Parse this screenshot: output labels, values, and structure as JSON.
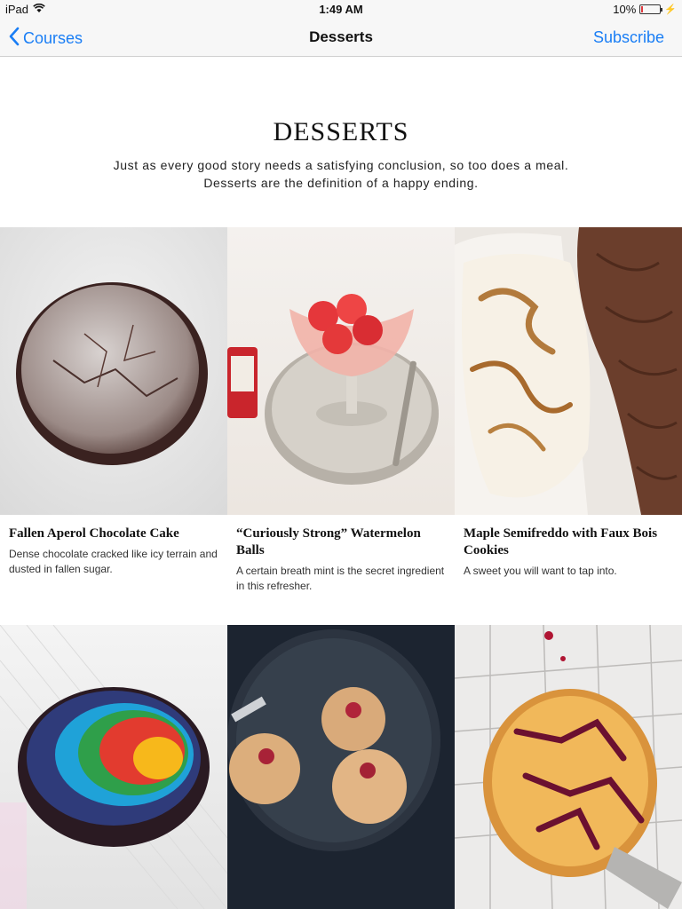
{
  "status": {
    "device": "iPad",
    "time": "1:49 AM",
    "battery": "10%",
    "battery_level": 0.1
  },
  "nav": {
    "back_label": "Courses",
    "title": "Desserts",
    "subscribe_label": "Subscribe"
  },
  "header": {
    "title": "DESSERTS",
    "description": "Just as every good story needs a satisfying conclusion, so too does a meal. Desserts are the definition of a happy ending."
  },
  "recipes": [
    {
      "title": "Fallen Aperol Chocolate Cake",
      "description": "Dense chocolate cracked like icy terrain and dusted in fallen sugar."
    },
    {
      "title": "“Curiously Strong” Watermelon Balls",
      "description": "A certain breath mint is the secret ingredient in this refresher."
    },
    {
      "title": "Maple Semifreddo with Faux Bois Cookies",
      "description": "A sweet you will want to tap into."
    }
  ],
  "colors": {
    "accent": "#1a7ef5"
  }
}
